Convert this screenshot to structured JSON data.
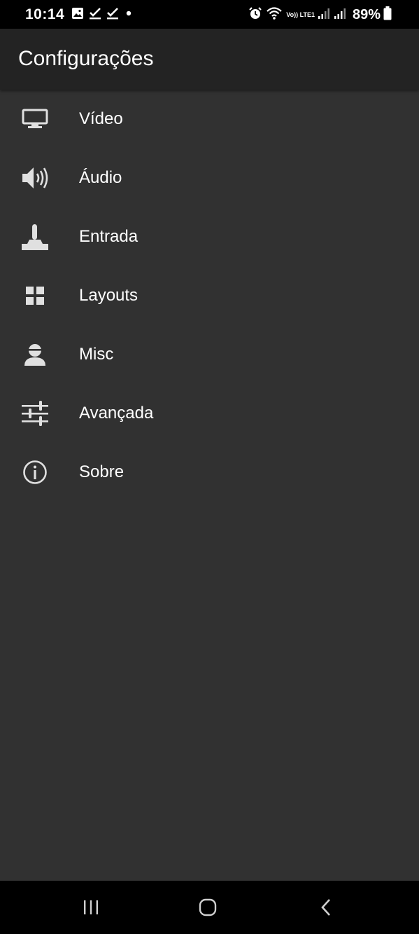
{
  "status_bar": {
    "time": "10:14",
    "battery_percent": "89%",
    "network_label": "Vo)) LTE1",
    "left_icons": [
      "gallery-icon",
      "check-icon",
      "check-icon",
      "dot-icon"
    ],
    "right_icons": [
      "alarm-icon",
      "wifi-icon",
      "signal-icon",
      "signal-icon",
      "battery-icon"
    ]
  },
  "app_bar": {
    "title": "Configurações"
  },
  "menu": {
    "items": [
      {
        "label": "Vídeo",
        "icon": "monitor-icon"
      },
      {
        "label": "Áudio",
        "icon": "speaker-icon"
      },
      {
        "label": "Entrada",
        "icon": "joystick-icon"
      },
      {
        "label": "Layouts",
        "icon": "grid-icon"
      },
      {
        "label": "Misc",
        "icon": "user-icon"
      },
      {
        "label": "Avançada",
        "icon": "sliders-icon"
      },
      {
        "label": "Sobre",
        "icon": "info-icon"
      }
    ]
  },
  "nav_bar": {
    "buttons": [
      "recent-apps-icon",
      "home-icon",
      "back-icon"
    ]
  },
  "colors": {
    "background": "#313131",
    "app_bar": "#232323",
    "status_bar": "#000000",
    "text": "#ffffff",
    "icon": "#e0e0e0"
  }
}
